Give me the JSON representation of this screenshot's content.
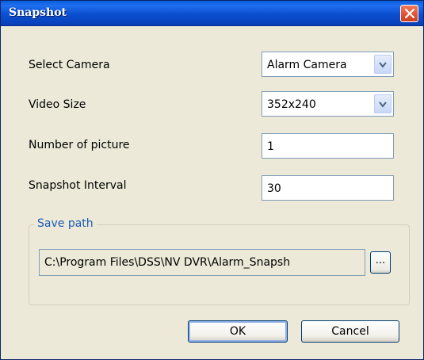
{
  "window": {
    "title": "Snapshot"
  },
  "form": {
    "select_camera_label": "Select Camera",
    "select_camera_value": "Alarm Camera",
    "video_size_label": "Video Size",
    "video_size_value": "352x240",
    "number_of_picture_label": "Number of picture",
    "number_of_picture_value": "1",
    "snapshot_interval_label": "Snapshot Interval",
    "snapshot_interval_value": "30"
  },
  "save_path": {
    "legend": "Save path",
    "value": "C:\\Program Files\\DSS\\NV DVR\\Alarm_Snapsh",
    "browse_label": "..."
  },
  "buttons": {
    "ok": "OK",
    "cancel": "Cancel"
  },
  "colors": {
    "title_bar": "#0b4fd0",
    "close_button": "#e0502e",
    "dialog_background": "#ece9d8",
    "group_legend": "#1c5ab8"
  },
  "icons": {
    "close": "close-icon",
    "dropdown": "chevron-down-icon"
  }
}
